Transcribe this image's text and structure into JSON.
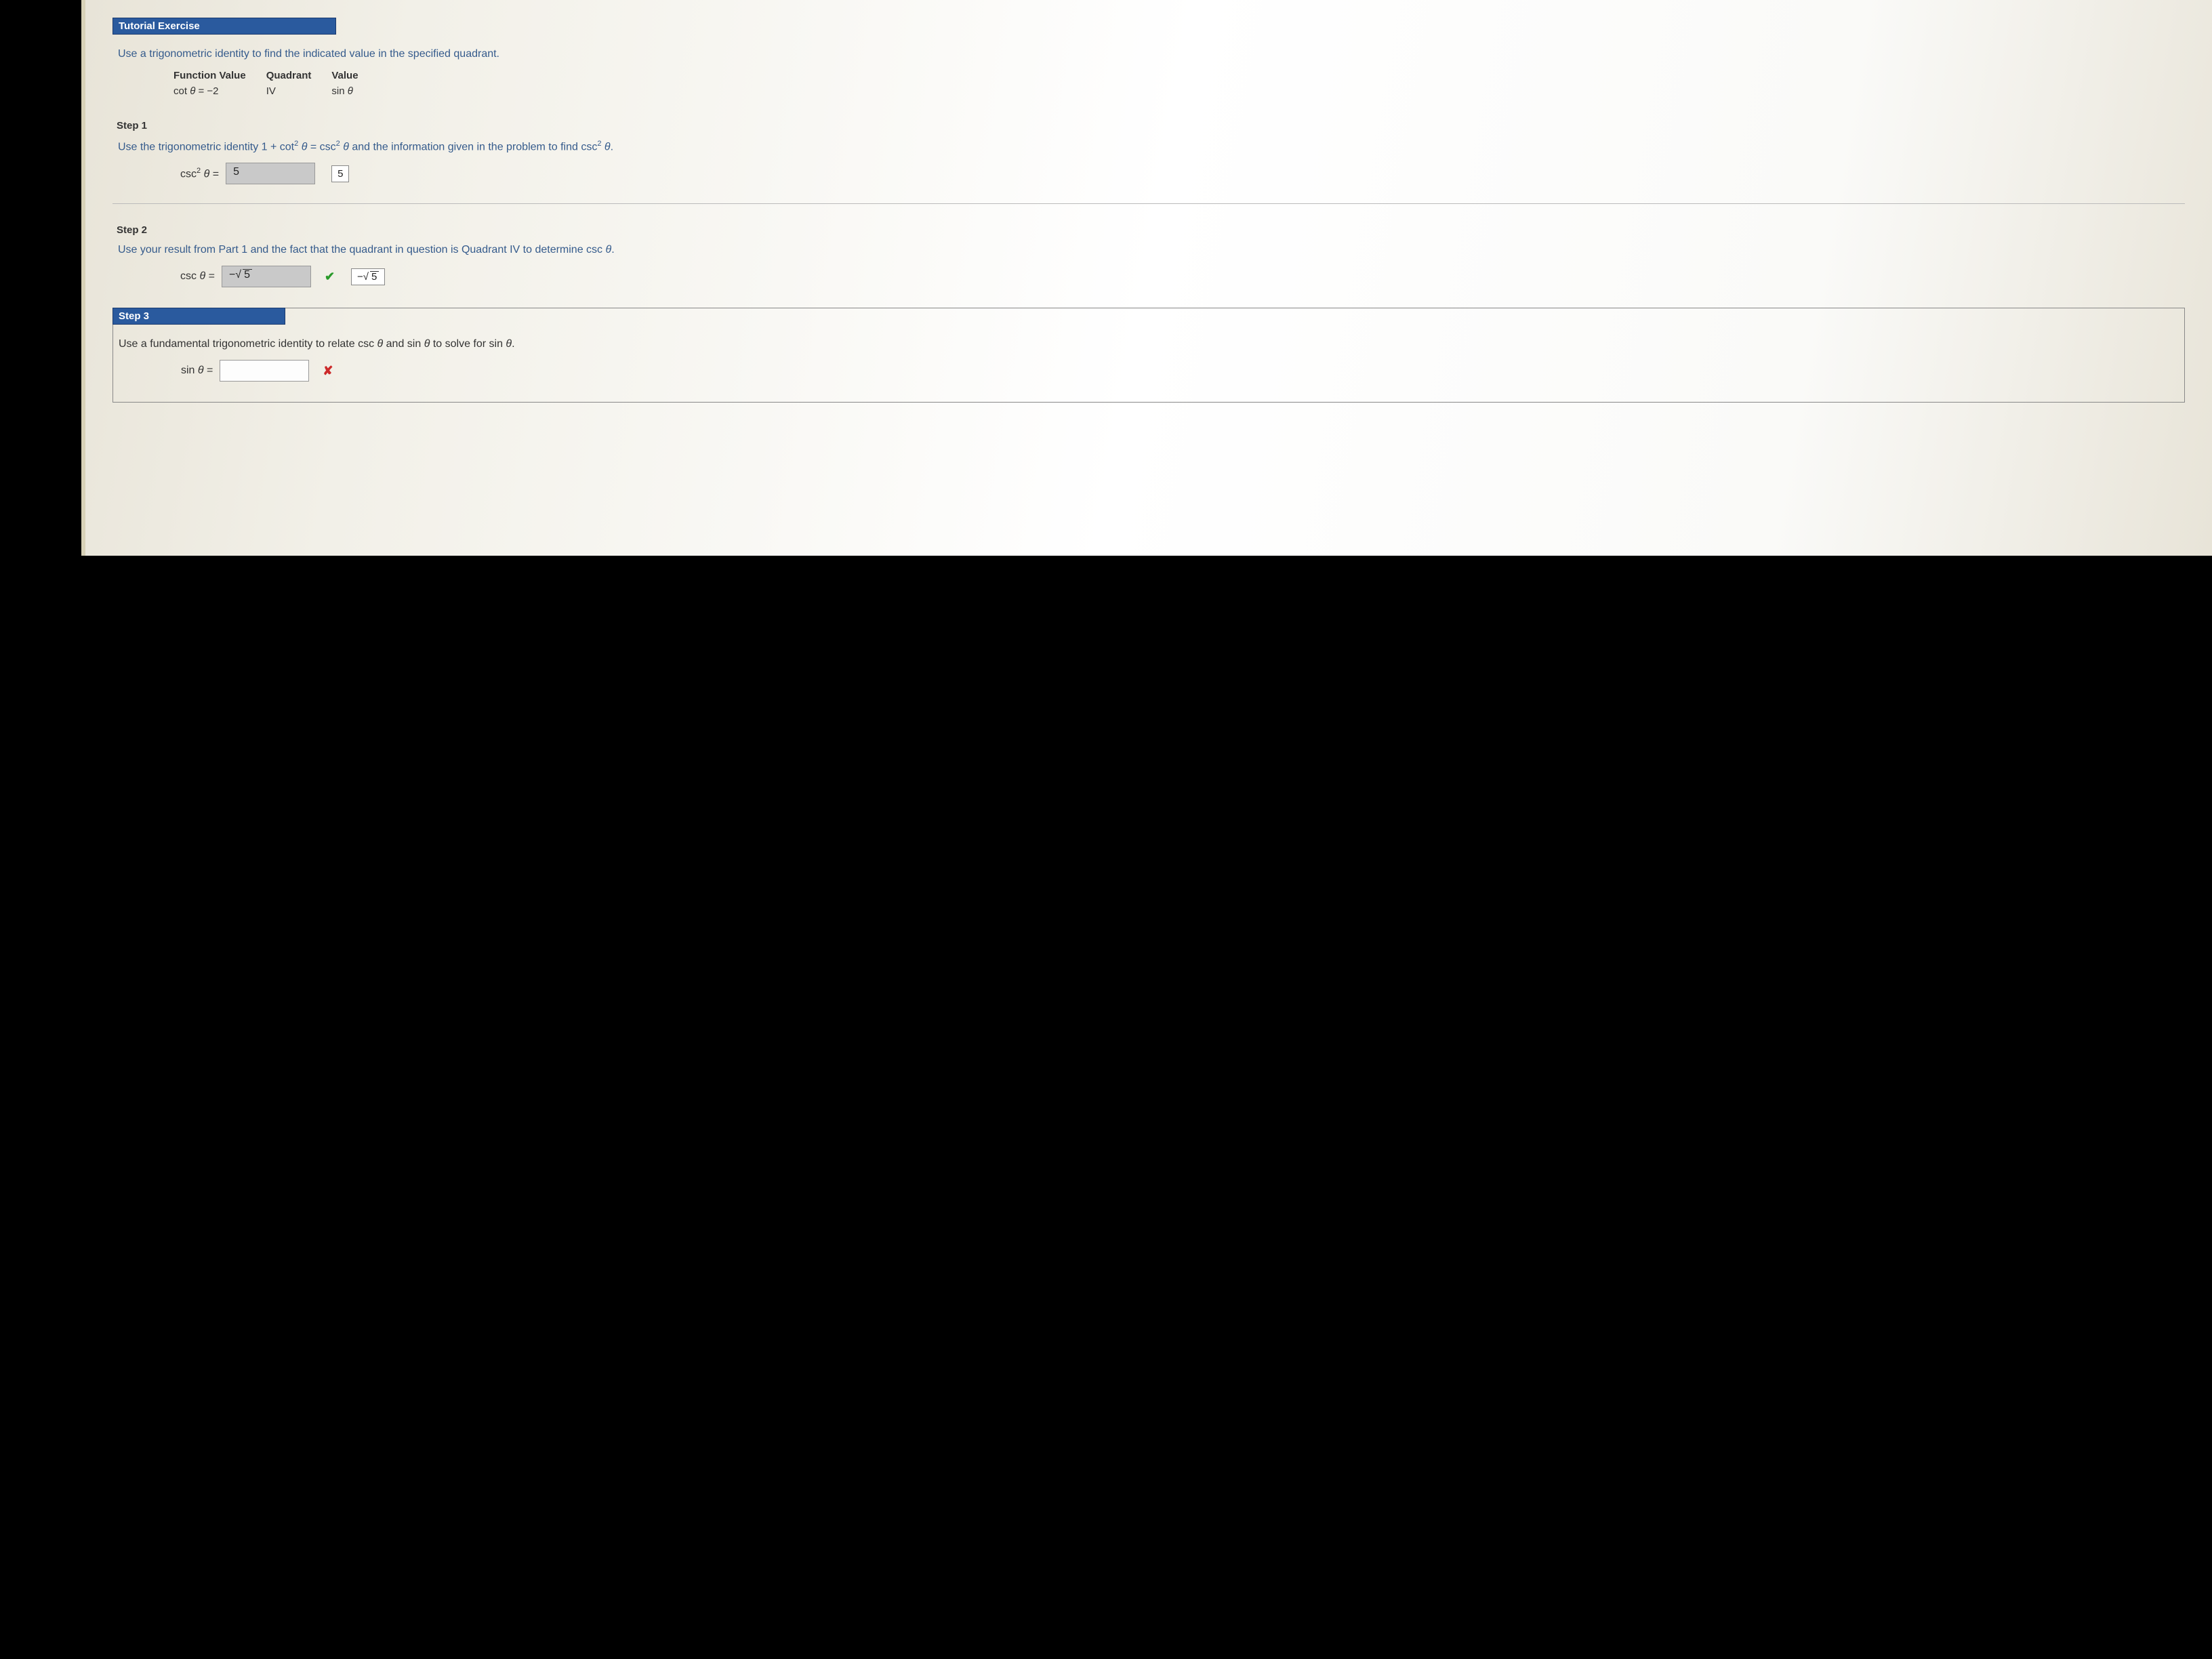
{
  "exercise": {
    "header": "Tutorial Exercise",
    "instruction": "Use a trigonometric identity to find the indicated value in the specified quadrant.",
    "table": {
      "h1": "Function Value",
      "h2": "Quadrant",
      "h3": "Value",
      "v1": "cot θ = −2",
      "v2": "IV",
      "v3": "sin θ"
    }
  },
  "step1": {
    "label": "Step 1",
    "text_a": "Use the trigonometric identity 1 + cot",
    "text_b": " θ = csc",
    "text_c": " θ and the information given in the problem to find csc",
    "text_d": " θ.",
    "eq_label": "csc² θ = ",
    "input": "5",
    "feedback": "5"
  },
  "step2": {
    "label": "Step 2",
    "text": "Use your result from Part 1 and the fact that the quadrant in question is Quadrant IV to determine csc θ.",
    "eq_label": "csc θ = ",
    "input": "−√5",
    "feedback": "−√5"
  },
  "step3": {
    "label": "Step 3",
    "text": "Use a fundamental trigonometric identity to relate csc θ and sin θ to solve for sin θ.",
    "eq_label": "sin θ = ",
    "input": ""
  }
}
